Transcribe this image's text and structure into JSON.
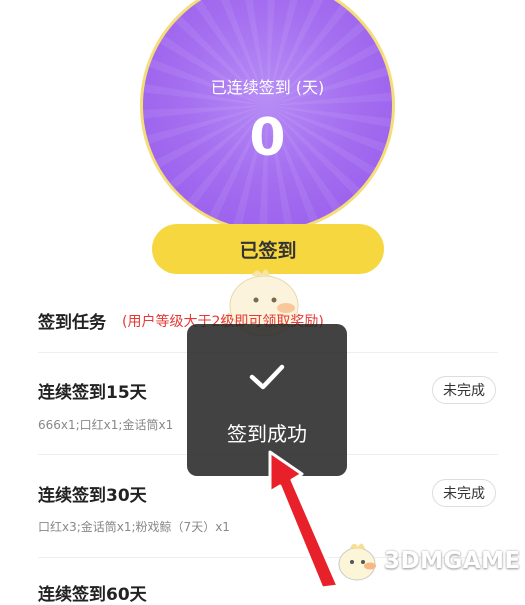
{
  "checkin": {
    "streak_label": "已连续签到 (天)",
    "streak_count": "0",
    "button_label": "已签到"
  },
  "tasks": {
    "title": "签到任务",
    "note": "(用户等级大于2级即可领取奖励)",
    "items": [
      {
        "name": "连续签到15天",
        "reward": "666x1;口红x1;金话筒x1",
        "status": "未完成"
      },
      {
        "name": "连续签到30天",
        "reward": "口红x3;金话筒x1;粉戏鲸（7天）x1",
        "status": "未完成"
      },
      {
        "name": "连续签到60天",
        "reward": "",
        "status": ""
      }
    ]
  },
  "toast": {
    "icon": "checkmark-icon",
    "text": "签到成功"
  },
  "watermark": {
    "text": "3DMGAME"
  },
  "colors": {
    "circle": "#9d63ee",
    "circle_border": "#f5dd7a",
    "button": "#f7d740",
    "note": "#e53935",
    "arrow": "#e8202a"
  }
}
